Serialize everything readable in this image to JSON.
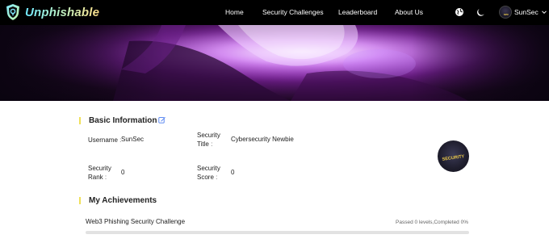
{
  "brand": {
    "name": "Unphishable"
  },
  "nav": {
    "links": [
      "Home",
      "Security Challenges",
      "Leaderboard",
      "About Us"
    ],
    "language_icon": "globe-icon",
    "theme_icon": "moon-icon",
    "user": {
      "name": "SunSec",
      "dropdown_icon": "chevron-down-icon"
    }
  },
  "basic_info": {
    "title": "Basic Information",
    "edit_icon": "edit-icon",
    "fields": {
      "username": {
        "label": "Username",
        "colon": ":",
        "value": "SunSec"
      },
      "security_title": {
        "label_line1": "Security",
        "label_line2": "Title",
        "colon": ":",
        "value": "Cybersecurity Newbie"
      },
      "security_rank": {
        "label_line1": "Security",
        "label_line2": "Rank",
        "colon": ":",
        "value": "0"
      },
      "security_score": {
        "label_line1": "Security",
        "label_line2": "Score",
        "colon": ":",
        "value": "0"
      }
    },
    "badge": {
      "text": "SECURITY"
    }
  },
  "achievements": {
    "title": "My Achievements",
    "items": [
      {
        "name": "Web3 Phishing Security Challenge",
        "status": "Passed 0 levels,Completed 0%",
        "progress": 0
      }
    ]
  },
  "colors": {
    "accent_bar": "#f0e05a",
    "nav_bg": "#000000",
    "banner_purple": "#b04ed2",
    "edit_icon": "#4a7cf0"
  }
}
